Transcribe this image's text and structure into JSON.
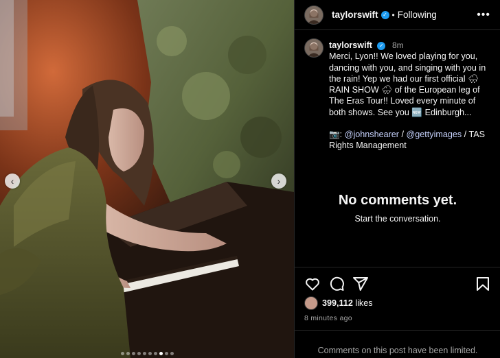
{
  "post": {
    "username": "taylorswift",
    "follow_state": "Following",
    "more_label": "•••",
    "caption_time": "8m",
    "caption_text": "Merci, Lyon!! We loved playing for you, dancing with you, and singing with you in the rain! Yep we had our first official 🌧 RAIN SHOW 🌧 of the European leg of The Eras Tour!! Loved every minute of both shows. See you 🆕 Edinburgh...",
    "credit_prefix": "📷: ",
    "credit_mention_1": "@johnshearer",
    "credit_sep": " / ",
    "credit_mention_2": "@gettyimages",
    "credit_suffix": " / TAS Rights Management",
    "empty_title": "No comments yet.",
    "empty_subtitle": "Start the conversation.",
    "likes_count": "399,112",
    "likes_word": " likes",
    "posted_ago": "8 minutes ago",
    "comments_limited": "Comments on this post have been limited."
  },
  "carousel": {
    "prev_glyph": "‹",
    "next_glyph": "›",
    "slide_count": 10,
    "active_index": 7
  },
  "icons": {
    "header": [
      "avatar",
      "verified-badge-icon",
      "more-options-icon"
    ],
    "actions": [
      "heart-icon",
      "comment-icon",
      "share-icon",
      "bookmark-icon"
    ]
  },
  "colors": {
    "background": "#000000",
    "text": "#f5f5f5",
    "muted": "#a8a8a8",
    "mention": "#c8d4ff",
    "verified": "#1d9bf0",
    "divider": "#262626"
  }
}
